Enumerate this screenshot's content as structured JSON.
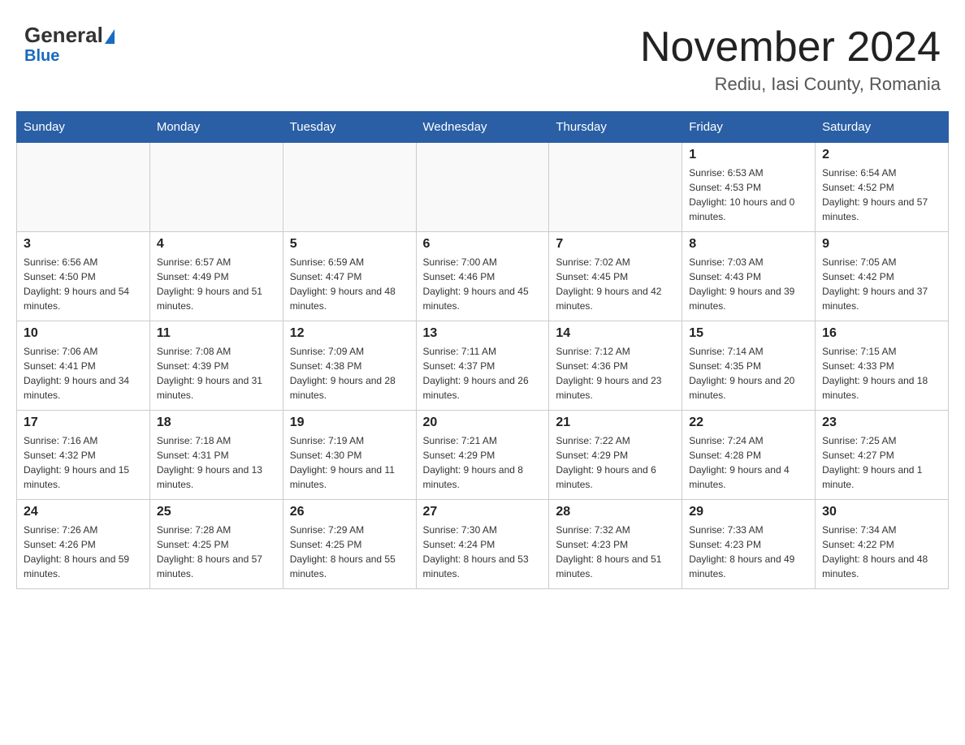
{
  "header": {
    "logo_general": "General",
    "logo_blue": "Blue",
    "month_year": "November 2024",
    "location": "Rediu, Iasi County, Romania"
  },
  "weekdays": [
    "Sunday",
    "Monday",
    "Tuesday",
    "Wednesday",
    "Thursday",
    "Friday",
    "Saturday"
  ],
  "weeks": [
    [
      {
        "day": "",
        "info": ""
      },
      {
        "day": "",
        "info": ""
      },
      {
        "day": "",
        "info": ""
      },
      {
        "day": "",
        "info": ""
      },
      {
        "day": "",
        "info": ""
      },
      {
        "day": "1",
        "info": "Sunrise: 6:53 AM\nSunset: 4:53 PM\nDaylight: 10 hours and 0 minutes."
      },
      {
        "day": "2",
        "info": "Sunrise: 6:54 AM\nSunset: 4:52 PM\nDaylight: 9 hours and 57 minutes."
      }
    ],
    [
      {
        "day": "3",
        "info": "Sunrise: 6:56 AM\nSunset: 4:50 PM\nDaylight: 9 hours and 54 minutes."
      },
      {
        "day": "4",
        "info": "Sunrise: 6:57 AM\nSunset: 4:49 PM\nDaylight: 9 hours and 51 minutes."
      },
      {
        "day": "5",
        "info": "Sunrise: 6:59 AM\nSunset: 4:47 PM\nDaylight: 9 hours and 48 minutes."
      },
      {
        "day": "6",
        "info": "Sunrise: 7:00 AM\nSunset: 4:46 PM\nDaylight: 9 hours and 45 minutes."
      },
      {
        "day": "7",
        "info": "Sunrise: 7:02 AM\nSunset: 4:45 PM\nDaylight: 9 hours and 42 minutes."
      },
      {
        "day": "8",
        "info": "Sunrise: 7:03 AM\nSunset: 4:43 PM\nDaylight: 9 hours and 39 minutes."
      },
      {
        "day": "9",
        "info": "Sunrise: 7:05 AM\nSunset: 4:42 PM\nDaylight: 9 hours and 37 minutes."
      }
    ],
    [
      {
        "day": "10",
        "info": "Sunrise: 7:06 AM\nSunset: 4:41 PM\nDaylight: 9 hours and 34 minutes."
      },
      {
        "day": "11",
        "info": "Sunrise: 7:08 AM\nSunset: 4:39 PM\nDaylight: 9 hours and 31 minutes."
      },
      {
        "day": "12",
        "info": "Sunrise: 7:09 AM\nSunset: 4:38 PM\nDaylight: 9 hours and 28 minutes."
      },
      {
        "day": "13",
        "info": "Sunrise: 7:11 AM\nSunset: 4:37 PM\nDaylight: 9 hours and 26 minutes."
      },
      {
        "day": "14",
        "info": "Sunrise: 7:12 AM\nSunset: 4:36 PM\nDaylight: 9 hours and 23 minutes."
      },
      {
        "day": "15",
        "info": "Sunrise: 7:14 AM\nSunset: 4:35 PM\nDaylight: 9 hours and 20 minutes."
      },
      {
        "day": "16",
        "info": "Sunrise: 7:15 AM\nSunset: 4:33 PM\nDaylight: 9 hours and 18 minutes."
      }
    ],
    [
      {
        "day": "17",
        "info": "Sunrise: 7:16 AM\nSunset: 4:32 PM\nDaylight: 9 hours and 15 minutes."
      },
      {
        "day": "18",
        "info": "Sunrise: 7:18 AM\nSunset: 4:31 PM\nDaylight: 9 hours and 13 minutes."
      },
      {
        "day": "19",
        "info": "Sunrise: 7:19 AM\nSunset: 4:30 PM\nDaylight: 9 hours and 11 minutes."
      },
      {
        "day": "20",
        "info": "Sunrise: 7:21 AM\nSunset: 4:29 PM\nDaylight: 9 hours and 8 minutes."
      },
      {
        "day": "21",
        "info": "Sunrise: 7:22 AM\nSunset: 4:29 PM\nDaylight: 9 hours and 6 minutes."
      },
      {
        "day": "22",
        "info": "Sunrise: 7:24 AM\nSunset: 4:28 PM\nDaylight: 9 hours and 4 minutes."
      },
      {
        "day": "23",
        "info": "Sunrise: 7:25 AM\nSunset: 4:27 PM\nDaylight: 9 hours and 1 minute."
      }
    ],
    [
      {
        "day": "24",
        "info": "Sunrise: 7:26 AM\nSunset: 4:26 PM\nDaylight: 8 hours and 59 minutes."
      },
      {
        "day": "25",
        "info": "Sunrise: 7:28 AM\nSunset: 4:25 PM\nDaylight: 8 hours and 57 minutes."
      },
      {
        "day": "26",
        "info": "Sunrise: 7:29 AM\nSunset: 4:25 PM\nDaylight: 8 hours and 55 minutes."
      },
      {
        "day": "27",
        "info": "Sunrise: 7:30 AM\nSunset: 4:24 PM\nDaylight: 8 hours and 53 minutes."
      },
      {
        "day": "28",
        "info": "Sunrise: 7:32 AM\nSunset: 4:23 PM\nDaylight: 8 hours and 51 minutes."
      },
      {
        "day": "29",
        "info": "Sunrise: 7:33 AM\nSunset: 4:23 PM\nDaylight: 8 hours and 49 minutes."
      },
      {
        "day": "30",
        "info": "Sunrise: 7:34 AM\nSunset: 4:22 PM\nDaylight: 8 hours and 48 minutes."
      }
    ]
  ]
}
